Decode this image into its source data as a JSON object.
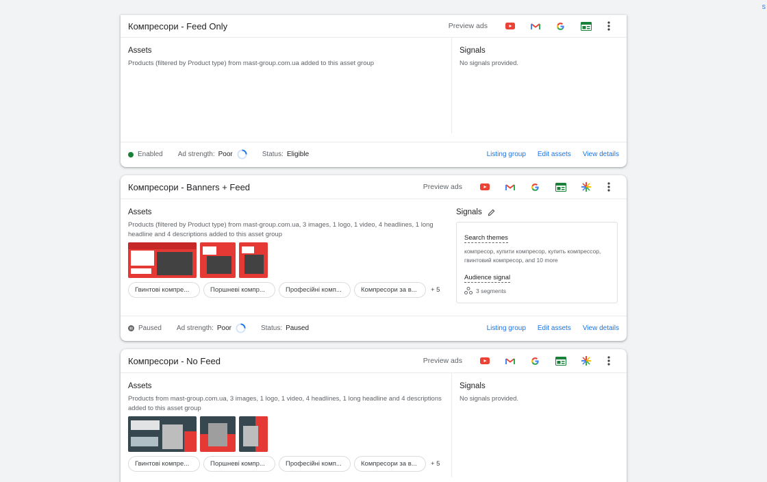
{
  "edge_mark": "S",
  "cards": [
    {
      "title": "Компресори - Feed Only",
      "preview_label": "Preview ads",
      "assets_heading": "Assets",
      "assets_description": "Products (filtered by Product type) from mast-group.com.ua added to this asset group",
      "signals_heading": "Signals",
      "signals_text": "No signals provided.",
      "status": "Enabled",
      "ad_strength_label": "Ad strength:",
      "ad_strength_value": "Poor",
      "status_label": "Status:",
      "status_value": "Eligible",
      "links": [
        "Listing group",
        "Edit assets",
        "View details"
      ]
    },
    {
      "title": "Компресори - Banners + Feed",
      "preview_label": "Preview ads",
      "assets_heading": "Assets",
      "assets_description": "Products (filtered by Product type) from mast-group.com.ua, 3 images, 1 logo, 1 video, 4 headlines, 1 long headline and 4 descriptions added to this asset group",
      "chips": [
        "Гвинтові компре...",
        "Поршневі компр...",
        "Професійні комп...",
        "Компресори за в..."
      ],
      "chips_more": "+ 5",
      "signals_heading": "Signals",
      "search_themes_label": "Search themes",
      "search_themes_text": "компресор, купити компресор, купить компрессор, гвинтовий компресор, and 10 more",
      "audience_label": "Audience signal",
      "segments_text": "3 segments",
      "status": "Paused",
      "ad_strength_label": "Ad strength:",
      "ad_strength_value": "Poor",
      "status_label": "Status:",
      "status_value": "Paused",
      "links": [
        "Listing group",
        "Edit assets",
        "View details"
      ]
    },
    {
      "title": "Компресори - No Feed",
      "preview_label": "Preview ads",
      "assets_heading": "Assets",
      "assets_description": "Products from mast-group.com.ua, 3 images, 1 logo, 1 video, 4 headlines, 1 long headline and 4 descriptions added to this asset group",
      "chips": [
        "Гвинтові компре...",
        "Поршневі компр...",
        "Професійні комп...",
        "Компресори за в..."
      ],
      "chips_more": "+ 5",
      "signals_heading": "Signals",
      "signals_text": "No signals provided."
    }
  ],
  "colors": {
    "accent_link": "#1a73e8",
    "enabled_dot": "#188038",
    "youtube_red": "#ea4335",
    "banner_red": "#e53935"
  },
  "icons": [
    "youtube-icon",
    "gmail-icon",
    "google-search-icon",
    "display-icon",
    "discover-icon",
    "more-vert-icon",
    "edit-pencil-icon",
    "segments-icon",
    "pause-icon",
    "ad-strength-ring-icon"
  ]
}
